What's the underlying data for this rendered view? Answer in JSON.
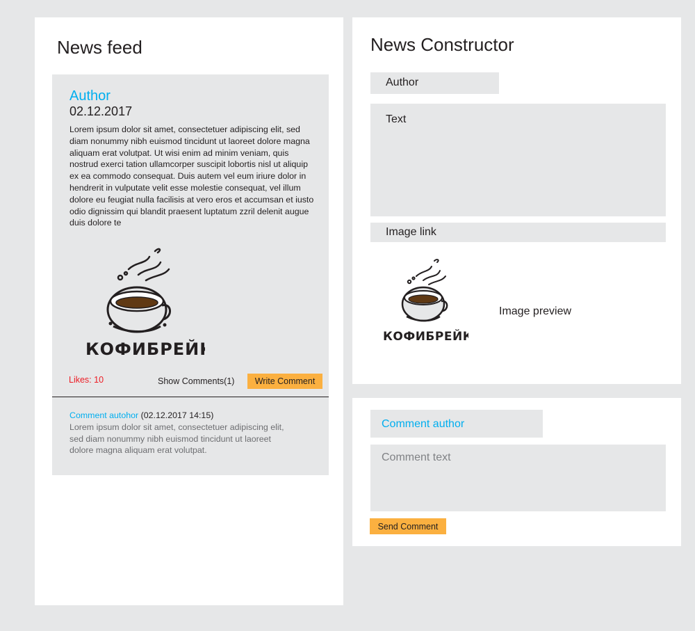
{
  "feed": {
    "title": "News feed",
    "post": {
      "author": "Author",
      "date": "02.12.2017",
      "text": "Lorem ipsum dolor sit amet, consectetuer adipiscing elit, sed diam nonummy nibh euismod tincidunt ut laoreet dolore magna aliquam erat volutpat. Ut wisi enim ad minim veniam, quis nostrud exerci tation ullamcorper suscipit lobortis nisl ut aliquip ex ea commodo consequat. Duis autem vel eum iriure dolor in hendrerit in vulputate velit esse molestie consequat, vel illum dolore eu feugiat nulla facilisis at vero eros et accumsan et iusto odio dignissim qui blandit praesent luptatum zzril delenit augue duis dolore te",
      "image_logo_text": "КОФИБРЕЙК",
      "likes": "Likes: 10",
      "show_comments": "Show Comments(1)",
      "write_comment": "Write Comment",
      "comment": {
        "author": "Comment autohor",
        "date": " (02.12.2017 14:15)",
        "text": "Lorem ipsum dolor sit amet, consectetuer adipiscing elit, sed diam nonummy nibh euismod tincidunt ut laoreet dolore magna aliquam erat volutpat."
      }
    }
  },
  "constructor": {
    "title": "News Constructor",
    "author_label": "Author",
    "text_label": "Text",
    "image_link_label": "Image link",
    "image_preview_label": "Image preview",
    "preview_logo_text": "КОФИБРЕЙК"
  },
  "comment_form": {
    "author_label": "Comment author",
    "text_label": "Comment text",
    "send_label": "Send Comment"
  },
  "colors": {
    "background": "#e6e7e8",
    "panel": "#ffffff",
    "accent_blue": "#00aeef",
    "button_orange": "#fbb040",
    "likes_red": "#ed1c24"
  },
  "icons": {
    "post_image": "coffee-cup-logo-icon",
    "preview_image": "coffee-cup-logo-icon"
  }
}
